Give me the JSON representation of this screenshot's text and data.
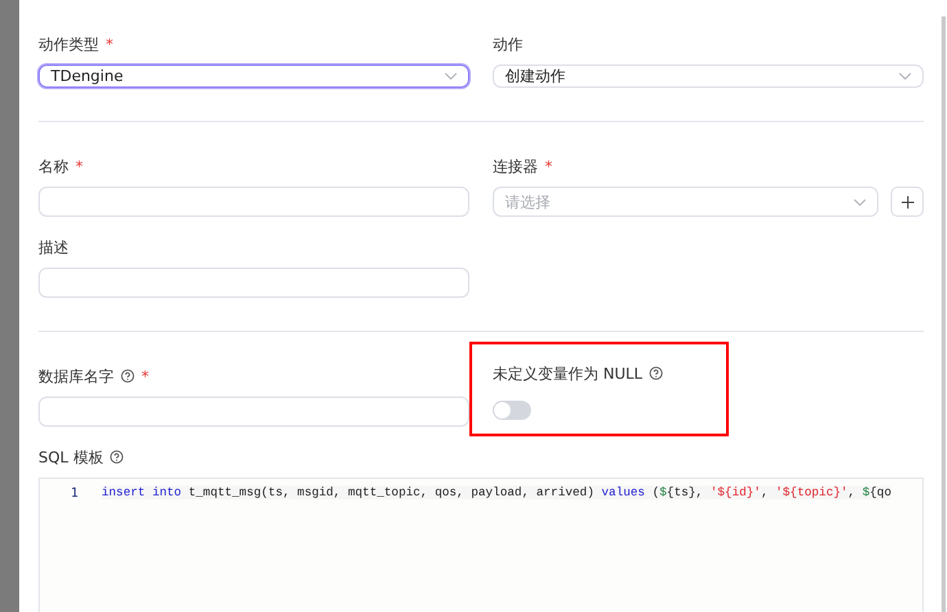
{
  "action_type": {
    "label": "动作类型",
    "required_mark": "*",
    "value": "TDengine",
    "focused": true
  },
  "action": {
    "label": "动作",
    "value": "创建动作"
  },
  "name": {
    "label": "名称",
    "required_mark": "*"
  },
  "connector": {
    "label": "连接器",
    "required_mark": "*",
    "placeholder": "请选择"
  },
  "description": {
    "label": "描述"
  },
  "database": {
    "label": "数据库名字",
    "required_mark": "*",
    "help": true
  },
  "undefined_as_null": {
    "label": "未定义变量作为 NULL",
    "help": true,
    "on": false,
    "highlighted": true
  },
  "sql_template": {
    "label": "SQL 模板",
    "help": true,
    "lines": [
      {
        "number": "1",
        "tokens": [
          {
            "kind": "keyword",
            "text": "insert "
          },
          {
            "kind": "keyword",
            "text": "into"
          },
          {
            "kind": "plain",
            "text": " t_mqtt_msg(ts, msgid, mqtt_topic, qos, payload, arrived) "
          },
          {
            "kind": "keyword",
            "text": "values"
          },
          {
            "kind": "plain",
            "text": " ("
          },
          {
            "kind": "variable",
            "text": "$"
          },
          {
            "kind": "plain",
            "text": "{ts}, "
          },
          {
            "kind": "string",
            "text": "'${id}'"
          },
          {
            "kind": "plain",
            "text": ", "
          },
          {
            "kind": "string",
            "text": "'${topic}'"
          },
          {
            "kind": "plain",
            "text": ", "
          },
          {
            "kind": "variable",
            "text": "$"
          },
          {
            "kind": "plain",
            "text": "{qo"
          }
        ]
      }
    ]
  }
}
